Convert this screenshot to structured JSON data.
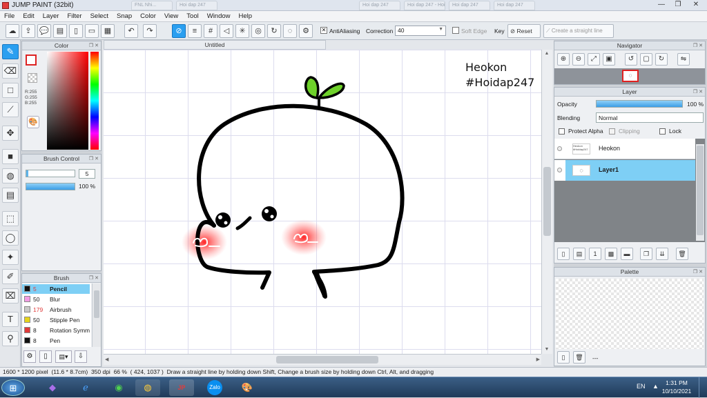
{
  "app": {
    "title": "JUMP PAINT (32bit)"
  },
  "window_buttons": [
    "—",
    "❐",
    "✕"
  ],
  "ghost_tabs": [
    "FNL Nhi...",
    "Hoi dap 247",
    "Hoi dap 247",
    "Hoi dap 247 - Hoi dap",
    "Hoi dap 247",
    "Hoi dap 247"
  ],
  "menu": [
    "File",
    "Edit",
    "Layer",
    "Filter",
    "Select",
    "Snap",
    "Color",
    "View",
    "Tool",
    "Window",
    "Help"
  ],
  "toolbar": {
    "antialiasing_label": "AntiAliasing",
    "correction_label": "Correction",
    "correction_value": "40",
    "soft_edge_label": "Soft Edge",
    "key_label": "Key",
    "reset_label": "Reset",
    "straight_line_label": "Create a straight line"
  },
  "color_panel": {
    "title": "Color",
    "r": "R:255",
    "g": "G:255",
    "b": "B:255"
  },
  "brush_control": {
    "title": "Brush Control",
    "size": "5",
    "opacity": "100 %"
  },
  "brush_panel": {
    "title": "Brush",
    "items": [
      {
        "size": "5",
        "name": "Pencil",
        "color": "#111111",
        "selected": true
      },
      {
        "size": "50",
        "name": "Blur",
        "color": "#f29ce5",
        "selected": false
      },
      {
        "size": "179",
        "name": "Airbrush",
        "color": "#c9c9c9",
        "selected": false
      },
      {
        "size": "50",
        "name": "Stipple Pen",
        "color": "#e5d31b",
        "selected": false
      },
      {
        "size": "8",
        "name": "Rotation Symm",
        "color": "#e03a3a",
        "selected": false
      },
      {
        "size": "8",
        "name": "Pen",
        "color": "#111111",
        "selected": false
      }
    ]
  },
  "document": {
    "tab": "Untitled",
    "text_line1": "Heokon",
    "text_line2": "#Hoidap247"
  },
  "navigator": {
    "title": "Navigator"
  },
  "layer_panel": {
    "title": "Layer",
    "opacity_label": "Opacity",
    "opacity_value": "100 %",
    "opacity_fraction": 1.0,
    "blending_label": "Blending",
    "blending_value": "Normal",
    "protect_alpha": "Protect Alpha",
    "clipping": "Clipping",
    "lock": "Lock",
    "layers": [
      {
        "name": "Heokon",
        "selected": false
      },
      {
        "name": "Layer1",
        "selected": true
      }
    ]
  },
  "palette": {
    "title": "Palette",
    "footer_text": "---"
  },
  "status": {
    "size": "1600 * 1200 pixel",
    "cm": "(11.6 * 8.7cm)",
    "dpi": "350 dpi",
    "zoom": "66 %",
    "coords": "( 424, 1037 )",
    "hint": "Draw a straight line by holding down Shift, Change a brush size by holding down Ctrl, Alt, and dragging"
  },
  "taskbar": {
    "lang": "EN",
    "time": "1:31 PM",
    "date": "10/10/2021"
  },
  "colors": {
    "accent": "#2a9ff0",
    "selection": "#7ecff5",
    "title_bar": "#dfe5ee"
  }
}
